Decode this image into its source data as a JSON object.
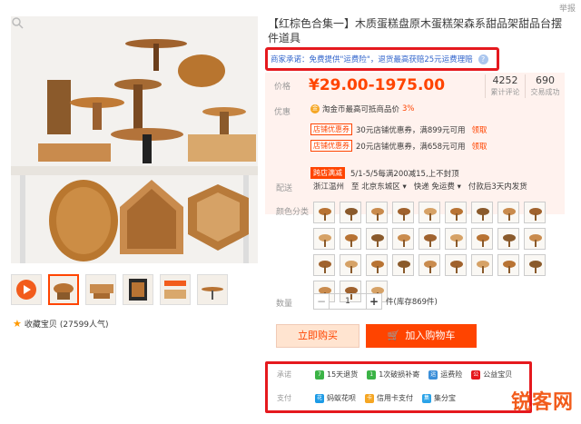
{
  "report_link": "举报",
  "product": {
    "title": "【红棕色合集一】木质蛋糕盘原木蛋糕架森系甜品架甜品台摆件道具"
  },
  "promise": {
    "label": "商家承诺：",
    "text": "免费提供\"运费险\"，退货最高获赔25元运费理赔",
    "help_icon": "?"
  },
  "price": {
    "label": "价格",
    "value": "¥29.00-1975.00",
    "reviews_count": "4252",
    "reviews_label": "累计评论",
    "sales_count": "690",
    "sales_label": "交易成功"
  },
  "promo": {
    "label": "优惠",
    "coin_text": "淘金币最高可抵商品价",
    "coin_pct": "3%",
    "coupons": [
      {
        "tag": "店铺优惠券",
        "text": "30元店铺优惠券，满899元可用",
        "action": "领取"
      },
      {
        "tag": "店铺优惠券",
        "text": "20元店铺优惠券，满658元可用",
        "action": "领取"
      }
    ],
    "fullcut_tag": "跨店满减",
    "fullcut_text": "5/1-5/5每满200减15,上不封顶"
  },
  "shipping": {
    "label": "配送",
    "from": "浙江温州",
    "to_prefix": "至",
    "to": "北京东城区",
    "method": "快递 免运费",
    "note": "付款后3天内发货"
  },
  "color": {
    "label": "颜色分类",
    "swatch_count": 30
  },
  "quantity": {
    "label": "数量",
    "minus": "−",
    "value": "1",
    "plus": "+",
    "stock": "件(库存869件)"
  },
  "actions": {
    "buy_now": "立即购买",
    "add_to_cart": "加入购物车"
  },
  "service": {
    "promise_label": "承诺",
    "promise_items": [
      {
        "icon": "7",
        "text": "15天退货",
        "color": "#3bb346"
      },
      {
        "icon": "1",
        "text": "1次破损补寄",
        "color": "#3bb346"
      },
      {
        "icon": "运",
        "text": "运费险",
        "color": "#3b8fd9"
      },
      {
        "icon": "公",
        "text": "公益宝贝",
        "color": "#e5191e"
      }
    ],
    "payment_label": "支付",
    "payment_items": [
      {
        "icon": "花",
        "text": "蚂蚁花呗",
        "color": "#1c9be6"
      },
      {
        "icon": "卡",
        "text": "信用卡支付",
        "color": "#f5a623"
      },
      {
        "icon": "集",
        "text": "集分宝",
        "color": "#2aa3e8"
      }
    ]
  },
  "favorite": {
    "text": "收藏宝贝",
    "count": "(27599人气)"
  },
  "watermark": "锐客网"
}
